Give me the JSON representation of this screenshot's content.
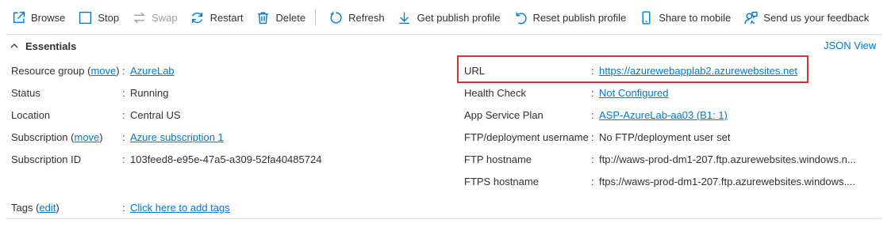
{
  "toolbar": {
    "browse": "Browse",
    "stop": "Stop",
    "swap": "Swap",
    "restart": "Restart",
    "delete": "Delete",
    "refresh": "Refresh",
    "get_publish_profile": "Get publish profile",
    "reset_publish_profile": "Reset publish profile",
    "share_to_mobile": "Share to mobile",
    "feedback": "Send us your feedback"
  },
  "essentials": {
    "title": "Essentials",
    "json_view": "JSON View"
  },
  "left": {
    "resource_group": {
      "label": "Resource group",
      "move_link": "move",
      "value": "AzureLab"
    },
    "status": {
      "label": "Status",
      "value": "Running"
    },
    "location": {
      "label": "Location",
      "value": "Central US"
    },
    "subscription": {
      "label": "Subscription",
      "move_link": "move",
      "value": "Azure subscription 1"
    },
    "subscription_id": {
      "label": "Subscription ID",
      "value": "103feed8-e95e-47a5-a309-52fa40485724"
    },
    "tags": {
      "label": "Tags",
      "edit_link": "edit",
      "value": "Click here to add tags"
    }
  },
  "right": {
    "url": {
      "label": "URL",
      "value": "https://azurewebapplab2.azurewebsites.net"
    },
    "health_check": {
      "label": "Health Check",
      "value": "Not Configured"
    },
    "app_service_plan": {
      "label": "App Service Plan",
      "value": "ASP-AzureLab-aa03 (B1: 1)"
    },
    "ftp_username": {
      "label": "FTP/deployment username",
      "value": "No FTP/deployment user set"
    },
    "ftp_hostname": {
      "label": "FTP hostname",
      "value": "ftp://waws-prod-dm1-207.ftp.azurewebsites.windows.n..."
    },
    "ftps_hostname": {
      "label": "FTPS hostname",
      "value": "ftps://waws-prod-dm1-207.ftp.azurewebsites.windows...."
    }
  },
  "colors": {
    "link": "#0078d4",
    "highlight": "#d13438",
    "text": "#323130",
    "disabled": "#a19f9d"
  }
}
